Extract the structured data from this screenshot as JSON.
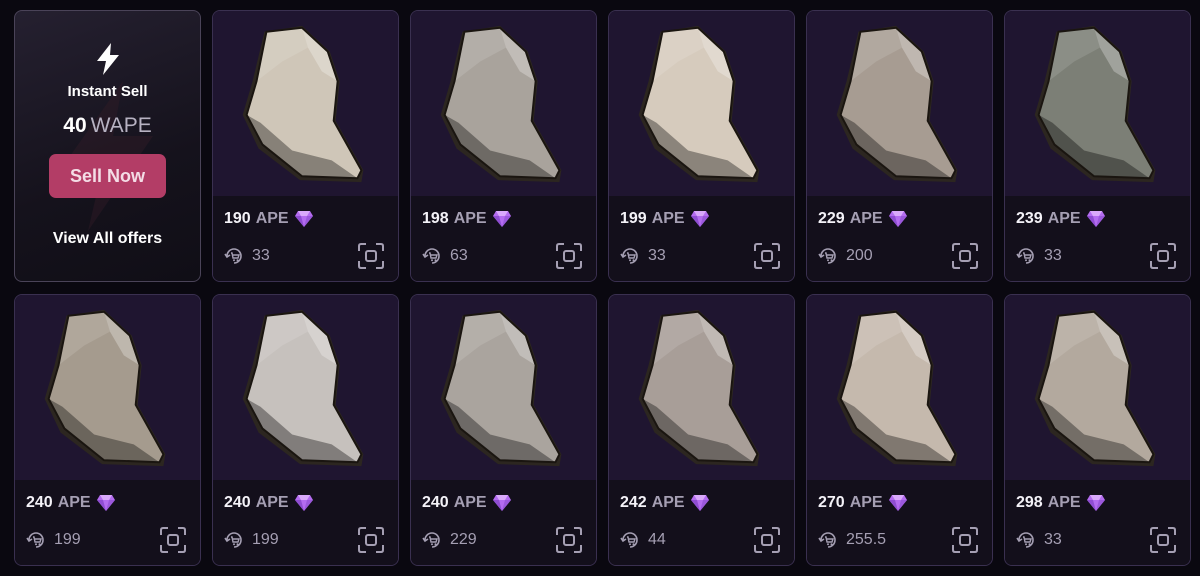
{
  "instant_sell": {
    "title": "Instant Sell",
    "amount": "40",
    "unit": "WAPE",
    "button_label": "Sell Now",
    "view_all_label": "View All offers"
  },
  "colors": {
    "accent": "#b33d66",
    "card_bg": "#1f1530",
    "gem": "#b46cf0"
  },
  "listings": [
    {
      "price": "190",
      "currency": "APE",
      "sales": "33",
      "rock": "#cfc6b8"
    },
    {
      "price": "198",
      "currency": "APE",
      "sales": "63",
      "rock": "#a9a39c"
    },
    {
      "price": "199",
      "currency": "APE",
      "sales": "33",
      "rock": "#d6cbbd"
    },
    {
      "price": "229",
      "currency": "APE",
      "sales": "200",
      "rock": "#a79c92"
    },
    {
      "price": "239",
      "currency": "APE",
      "sales": "33",
      "rock": "#7c7f76"
    },
    {
      "price": "240",
      "currency": "APE",
      "sales": "199",
      "rock": "#a59b8e"
    },
    {
      "price": "240",
      "currency": "APE",
      "sales": "199",
      "rock": "#c6c1bd"
    },
    {
      "price": "240",
      "currency": "APE",
      "sales": "229",
      "rock": "#aaa49e"
    },
    {
      "price": "242",
      "currency": "APE",
      "sales": "44",
      "rock": "#a89e98"
    },
    {
      "price": "270",
      "currency": "APE",
      "sales": "255.5",
      "rock": "#c5b9ad"
    },
    {
      "price": "298",
      "currency": "APE",
      "sales": "33",
      "rock": "#b3a99e"
    }
  ]
}
